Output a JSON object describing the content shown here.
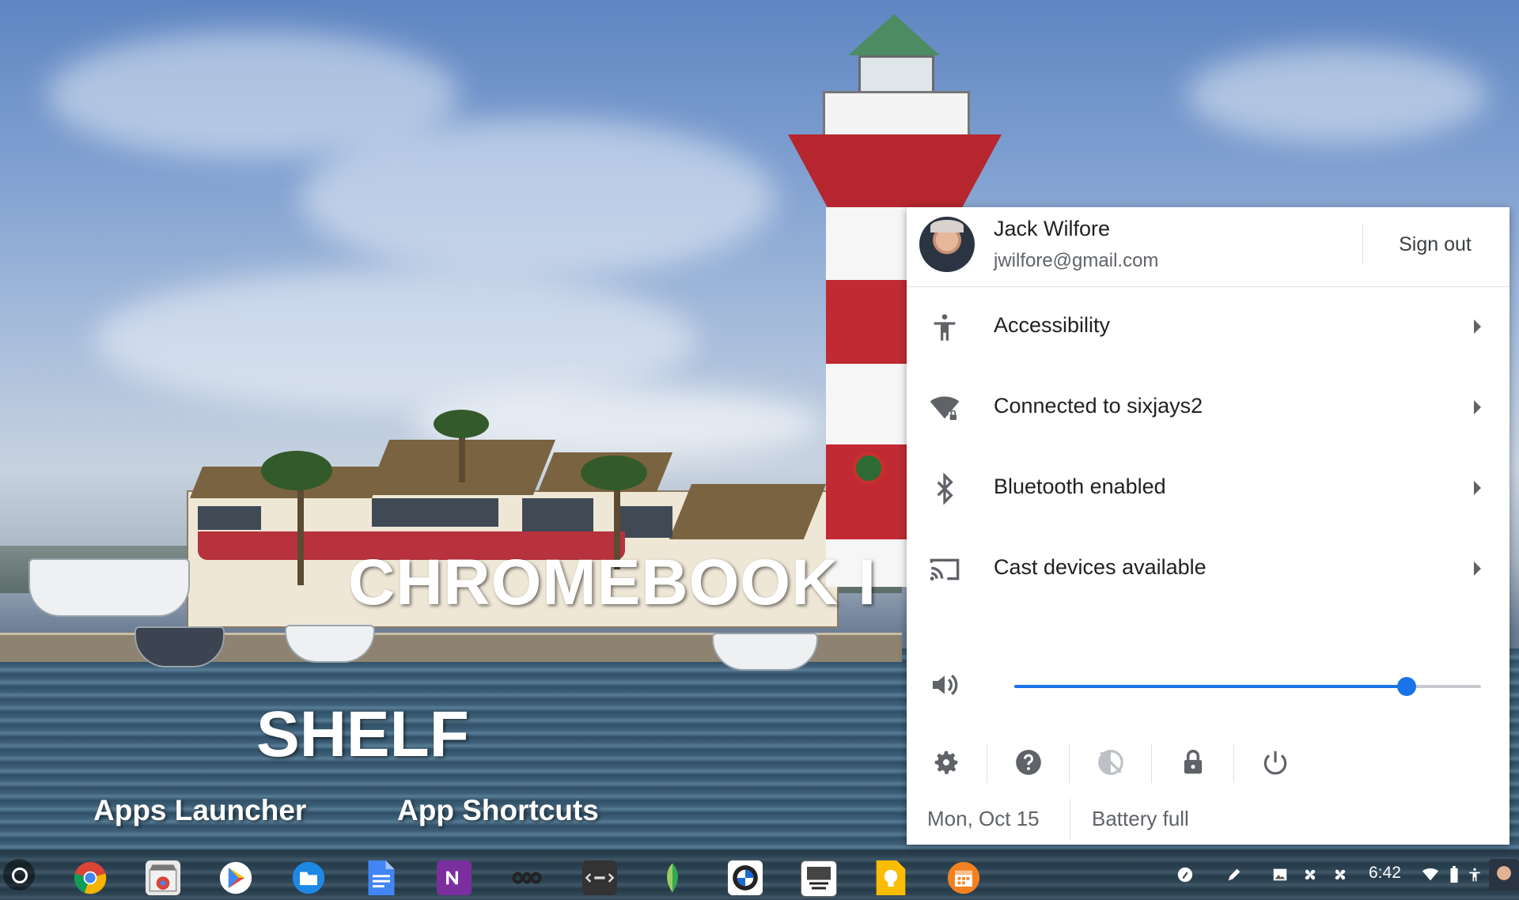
{
  "overlay": {
    "title": "CHROMEBOOK I",
    "subtitle": "SHELF",
    "label_launcher": "Apps Launcher",
    "label_shortcuts": "App Shortcuts"
  },
  "tray": {
    "user_name": "Jack Wilfore",
    "user_email": "jwilfore@gmail.com",
    "sign_out": "Sign out",
    "items": [
      {
        "label": "Accessibility",
        "icon": "accessibility-icon"
      },
      {
        "label": "Connected to sixjays2",
        "icon": "wifi-locked-icon"
      },
      {
        "label": "Bluetooth enabled",
        "icon": "bluetooth-icon"
      },
      {
        "label": "Cast devices available",
        "icon": "cast-icon"
      }
    ],
    "volume_level": 0.84,
    "actions": [
      "settings-icon",
      "help-icon",
      "night-light-off-icon",
      "lock-icon",
      "power-icon"
    ],
    "date": "Mon, Oct 15",
    "battery": "Battery full"
  },
  "shelf": {
    "apps": [
      "chrome-icon",
      "chrome-web-store-icon",
      "play-store-icon",
      "files-icon",
      "docs-icon",
      "onenote-icon",
      "infinity-icon",
      "txt-editor-icon",
      "snapseed-icon",
      "bmw-icon",
      "bmw-genius-icon",
      "keep-icon",
      "calendar-icon"
    ],
    "status_icons": [
      "pen-tools-icon",
      "stylus-icon",
      "image-icon",
      "fan-icon",
      "fan-icon",
      "wifi-icon",
      "battery-icon",
      "accessibility-icon"
    ],
    "time": "6:42"
  },
  "colors": {
    "accent": "#1a73e8",
    "panel": "#ffffff",
    "text_primary": "#202124",
    "text_secondary": "#5f6368"
  }
}
